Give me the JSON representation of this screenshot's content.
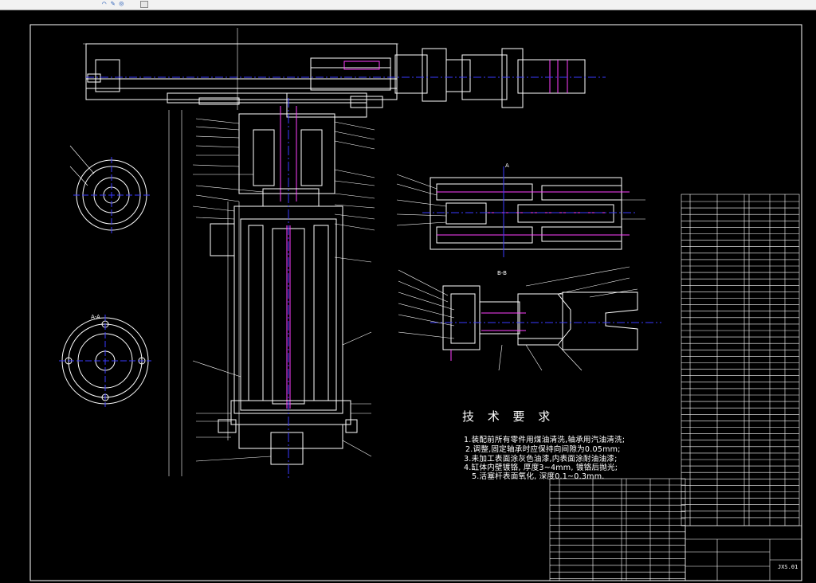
{
  "window": {
    "toolbar_glyph": "⌒ ✎ ◎"
  },
  "drawing": {
    "tech_title": "技 术 要 求",
    "requirements": [
      "1.装配前所有零件用煤油清洗,轴承用汽油清洗;",
      "2.调整,固定轴承时应保持向间隙为0.05mm;",
      "3.未加工表面涂灰色油漆,内表面涂耐油油漆;",
      "4.缸体内壁镀铬, 厚度3~4mm, 镀铬后抛光;",
      "5.活塞杆表面氧化, 深度0.1~0.3mm."
    ],
    "section_labels": [
      "A",
      "A-A",
      "B-B"
    ],
    "title_block": {
      "drawing_no": "JXS.01"
    }
  },
  "colors": {
    "background": "#000000",
    "line": "#ffffff",
    "centerline": "#3a3aff",
    "section": "#ff40ff"
  }
}
